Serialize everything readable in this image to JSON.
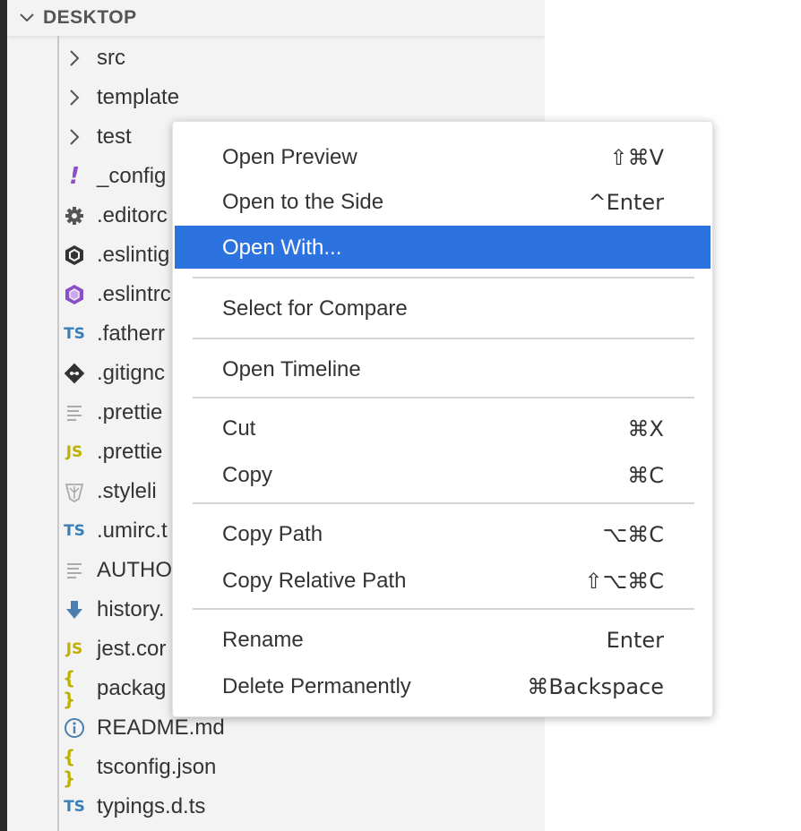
{
  "explorer": {
    "section_title": "DESKTOP",
    "items": [
      {
        "label": "src",
        "icon": "chevron-right-icon"
      },
      {
        "label": "template",
        "icon": "chevron-right-icon"
      },
      {
        "label": "test",
        "icon": "chevron-right-icon"
      },
      {
        "label": "_config",
        "icon": "exclamation-icon",
        "icon_glyph": "!"
      },
      {
        "label": ".editorc",
        "icon": "gear-icon"
      },
      {
        "label": ".eslintig",
        "icon": "eslint-icon"
      },
      {
        "label": ".eslintrc",
        "icon": "eslint-purple-icon"
      },
      {
        "label": ".fatherr",
        "icon": "typescript-icon",
        "icon_glyph": "TS"
      },
      {
        "label": ".gitignc",
        "icon": "git-icon"
      },
      {
        "label": ".prettie",
        "icon": "text-lines-icon"
      },
      {
        "label": ".prettie",
        "icon": "javascript-icon",
        "icon_glyph": "JS"
      },
      {
        "label": ".styleli",
        "icon": "stylelint-icon"
      },
      {
        "label": ".umirc.t",
        "icon": "typescript-icon",
        "icon_glyph": "TS"
      },
      {
        "label": "AUTHO",
        "icon": "text-lines-icon"
      },
      {
        "label": "history.",
        "icon": "download-arrow-icon"
      },
      {
        "label": "jest.cor",
        "icon": "javascript-icon",
        "icon_glyph": "JS"
      },
      {
        "label": "packag",
        "icon": "json-icon",
        "icon_glyph": "{ }"
      },
      {
        "label": "README.md",
        "icon": "info-icon"
      },
      {
        "label": "tsconfig.json",
        "icon": "json-icon",
        "icon_glyph": "{ }"
      },
      {
        "label": "typings.d.ts",
        "icon": "typescript-icon",
        "icon_glyph": "TS"
      }
    ]
  },
  "context_menu": {
    "items": [
      {
        "label": "Open Preview",
        "shortcut": "⇧⌘V"
      },
      {
        "label": "Open to the Side",
        "shortcut": "^Enter"
      },
      {
        "label": "Open With...",
        "shortcut": "",
        "selected": true
      },
      {
        "label": "Select for Compare",
        "shortcut": ""
      },
      {
        "label": "Open Timeline",
        "shortcut": ""
      },
      {
        "label": "Cut",
        "shortcut": "⌘X"
      },
      {
        "label": "Copy",
        "shortcut": "⌘C"
      },
      {
        "label": "Copy Path",
        "shortcut": "⌥⌘C"
      },
      {
        "label": "Copy Relative Path",
        "shortcut": "⇧⌥⌘C"
      },
      {
        "label": "Rename",
        "shortcut": "Enter"
      },
      {
        "label": "Delete Permanently",
        "shortcut": "⌘Backspace"
      }
    ]
  },
  "colors": {
    "selection": "#2d73e0",
    "sidebar_bg": "#f3f3f3",
    "typescript": "#3b7fb8",
    "javascript": "#c0b000",
    "eslint_purple": "#8a4fc9"
  }
}
